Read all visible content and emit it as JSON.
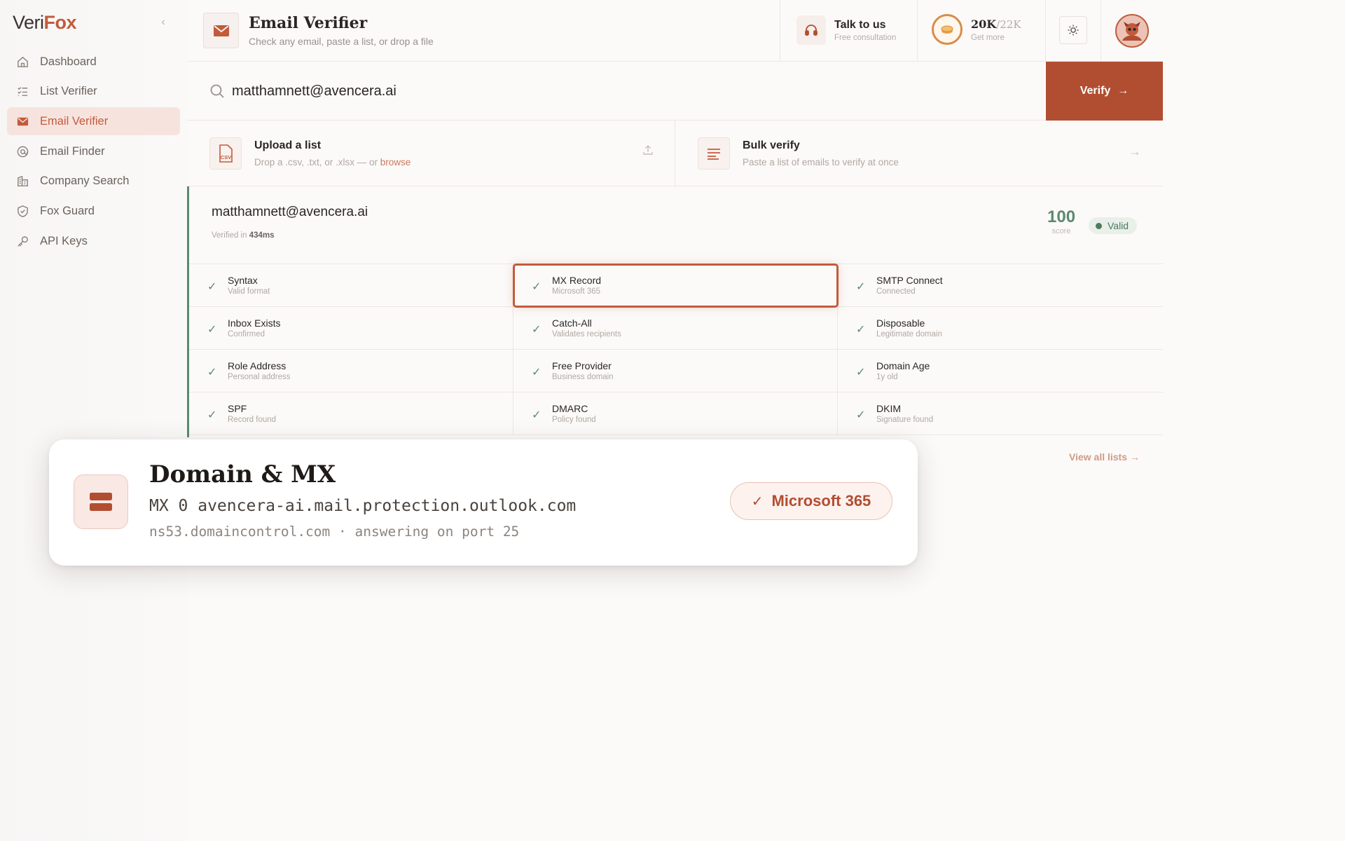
{
  "app": {
    "logo_part1": "Veri",
    "logo_part2": "Fox",
    "brand_color": "#c25b3c"
  },
  "sidebar": {
    "items": [
      {
        "label": "Dashboard",
        "icon": "home-icon",
        "active": false
      },
      {
        "label": "List Verifier",
        "icon": "list-icon",
        "active": false
      },
      {
        "label": "Email Verifier",
        "icon": "mail-icon",
        "active": true
      },
      {
        "label": "Email Finder",
        "icon": "at-search-icon",
        "active": false
      },
      {
        "label": "Company Search",
        "icon": "building-icon",
        "active": false
      },
      {
        "label": "Fox Guard",
        "icon": "shield-check-icon",
        "active": false
      },
      {
        "label": "API Keys",
        "icon": "key-icon",
        "active": false
      }
    ]
  },
  "header": {
    "title": "Email Verifier",
    "subtitle": "Check any email, paste a list, or drop a file",
    "talk_title": "Talk to us",
    "talk_sub": "Free consultation",
    "credits_value": "20K",
    "credits_max": "/22K",
    "credits_sub": "Get more"
  },
  "search": {
    "value": "matthamnett@avencera.ai",
    "button_label": "Verify"
  },
  "upload": {
    "title": "Upload a list",
    "sub_prefix": "Drop a .csv, .txt, or .xlsx — or ",
    "browse": "browse",
    "icon_label": "CSV"
  },
  "bulk": {
    "title": "Bulk verify",
    "sub": "Paste a list of emails to verify at once"
  },
  "result": {
    "email": "matthamnett@avencera.ai",
    "time_prefix": "Verified in ",
    "time_value": "434ms",
    "score": "100",
    "score_label": "score",
    "status": "Valid",
    "status_color": "#4f7a5f",
    "checks": [
      {
        "title": "Syntax",
        "sub": "Valid format"
      },
      {
        "title": "MX Record",
        "sub": "Microsoft 365",
        "highlight": true
      },
      {
        "title": "SMTP Connect",
        "sub": "Connected"
      },
      {
        "title": "Inbox Exists",
        "sub": "Confirmed"
      },
      {
        "title": "Catch-All",
        "sub": "Validates recipients"
      },
      {
        "title": "Disposable",
        "sub": "Legitimate domain"
      },
      {
        "title": "Role Address",
        "sub": "Personal address"
      },
      {
        "title": "Free Provider",
        "sub": "Business domain"
      },
      {
        "title": "Domain Age",
        "sub": "1y old"
      },
      {
        "title": "SPF",
        "sub": "Record found"
      },
      {
        "title": "DMARC",
        "sub": "Policy found"
      },
      {
        "title": "DKIM",
        "sub": "Signature found"
      }
    ]
  },
  "lists": {
    "view_all": "View all lists"
  },
  "popup": {
    "title": "Domain & MX",
    "mx_line": "MX 0 avencera-ai.mail.protection.outlook.com",
    "ns_line": "ns53.domaincontrol.com · answering on port 25",
    "badge": "Microsoft 365"
  }
}
